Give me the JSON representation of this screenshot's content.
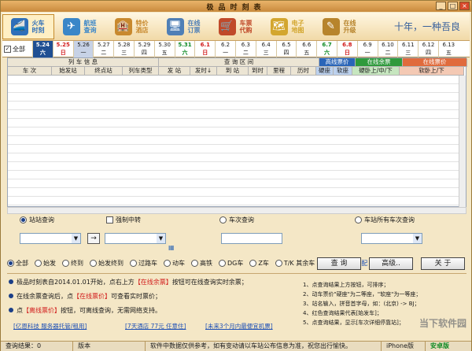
{
  "window": {
    "title": "极品时刻表",
    "minimize": "_",
    "maximize": "□",
    "close": "×"
  },
  "toolbar": {
    "items": [
      {
        "label": "火车时刻",
        "icon": "train-icon",
        "glyph": "🚄",
        "color": "#2f6fb9"
      },
      {
        "label": "航班查询",
        "icon": "plane-icon",
        "glyph": "✈",
        "color": "#3a86c8"
      },
      {
        "label": "特价酒店",
        "icon": "hotel-icon",
        "glyph": "🏨",
        "color": "#c8892e"
      },
      {
        "label": "在线订票",
        "icon": "ticket-icon",
        "glyph": "🖥",
        "color": "#4f7fb6"
      },
      {
        "label": "车票代购",
        "icon": "purchase-icon",
        "glyph": "🛒",
        "color": "#c04a2a"
      },
      {
        "label": "电子地图",
        "icon": "map-icon",
        "glyph": "🗺",
        "color": "#d3a62e"
      },
      {
        "label": "在线升级",
        "icon": "upgrade-icon",
        "glyph": "✎",
        "color": "#b7842c"
      }
    ],
    "slogan": "十年，一种吾良"
  },
  "dates": {
    "all_label": "全部",
    "items": [
      {
        "date": "5.24",
        "weekday": "六",
        "style": "today"
      },
      {
        "date": "5.25",
        "weekday": "日",
        "style": "red"
      },
      {
        "date": "5.26",
        "weekday": "一",
        "style": "sel"
      },
      {
        "date": "5.27",
        "weekday": "二",
        "style": ""
      },
      {
        "date": "5.28",
        "weekday": "三",
        "style": ""
      },
      {
        "date": "5.29",
        "weekday": "四",
        "style": ""
      },
      {
        "date": "5.30",
        "weekday": "五",
        "style": ""
      },
      {
        "date": "5.31",
        "weekday": "六",
        "style": "green"
      },
      {
        "date": "6.1",
        "weekday": "日",
        "style": "red"
      },
      {
        "date": "6.2",
        "weekday": "一",
        "style": ""
      },
      {
        "date": "6.3",
        "weekday": "二",
        "style": ""
      },
      {
        "date": "6.4",
        "weekday": "三",
        "style": ""
      },
      {
        "date": "6.5",
        "weekday": "四",
        "style": ""
      },
      {
        "date": "6.6",
        "weekday": "五",
        "style": ""
      },
      {
        "date": "6.7",
        "weekday": "六",
        "style": "green"
      },
      {
        "date": "6.8",
        "weekday": "日",
        "style": "red"
      },
      {
        "date": "6.9",
        "weekday": "一",
        "style": ""
      },
      {
        "date": "6.10",
        "weekday": "二",
        "style": ""
      },
      {
        "date": "6.11",
        "weekday": "三",
        "style": ""
      },
      {
        "date": "6.12",
        "weekday": "四",
        "style": ""
      },
      {
        "date": "6.13",
        "weekday": "五",
        "style": ""
      }
    ]
  },
  "table": {
    "group_headers": [
      "列 车 信 息",
      "查 询 区 间",
      "高线票价",
      "在线余票",
      "在线票价"
    ],
    "columns": [
      "车 次",
      "始发站",
      "终点站",
      "列车类型",
      "发 站",
      "发时↓",
      "到 站",
      "到时",
      "里程",
      "历时",
      "硬座",
      "软座",
      "硬卧上/中/下",
      "软卧上/下"
    ],
    "rows": []
  },
  "query": {
    "station_label": "站站查询",
    "transfer_label": "强制中转",
    "swap_label": "→",
    "train_label": "车次查询",
    "all_trains_label": "车站所有车次查询"
  },
  "filters": [
    "全部",
    "始发",
    "终到",
    "始发终到",
    "过路车",
    "动车",
    "高铁",
    "DG车",
    "Z车",
    "T/K 其余车",
    "站名精确匹配"
  ],
  "buttons": {
    "search": "查 询",
    "advanced": "高级..",
    "about": "关 于"
  },
  "tips": [
    {
      "pre": "极品时刻表自2014.01.01开始，点右上方",
      "hl": "【在线余票】",
      "post": "按钮可在线查询实时余票；"
    },
    {
      "pre": "在线余票查询后，点",
      "hl": "【在线票价】",
      "post": "可查看实时票价；"
    },
    {
      "pre": "点",
      "hl": "【离线票价】",
      "post": "按钮，可离线查询，无需网络支持。"
    }
  ],
  "notes": [
    "1、点查询结果上方按钮，可排序；",
    "2、动车票价\"硬座\"为二等座，\"软座\"为一等座；",
    "3、站名输入，拼音首字母，如：(北京) -> BJ；",
    "4、红色查询结果代表[始发车]；",
    "5、点查询结果，显示[车次详细停靠站]；"
  ],
  "links": [
    "[亿恩科技 服务器托管/租用]",
    "[7天酒店 77元 任意住]",
    "[未来3个月内最便宜机票]"
  ],
  "status": {
    "results": "查询结果：0",
    "version": "版本",
    "message": "软件中数据仅供参考，如有变动请以车站公布信息为准，祝您出行愉快。",
    "iphone": "iPhone版",
    "android": "安卓版"
  },
  "watermark": "当下软件园"
}
